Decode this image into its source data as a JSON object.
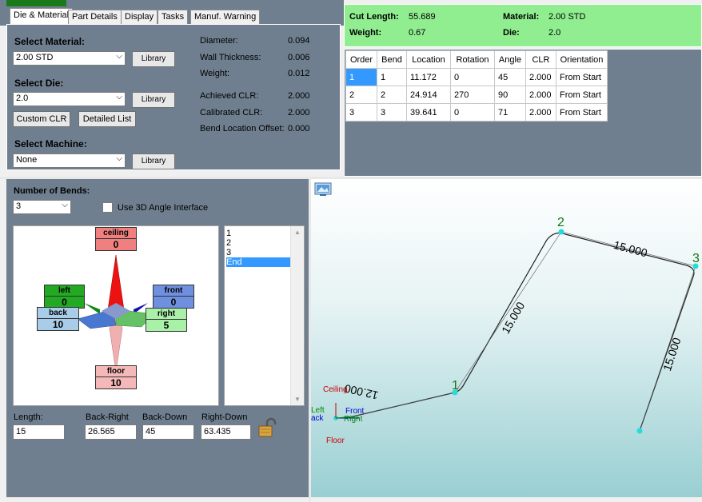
{
  "tabs": [
    "Die & Material",
    "Part Details",
    "Display",
    "Tasks",
    "Manuf. Warning"
  ],
  "die_material": {
    "select_material_label": "Select Material:",
    "material_value": "2.00 STD",
    "library_label": "Library",
    "select_die_label": "Select Die:",
    "die_value": "2.0",
    "custom_clr_label": "Custom CLR",
    "detailed_list_label": "Detailed List",
    "select_machine_label": "Select Machine:",
    "machine_value": "None",
    "props": [
      {
        "label": "Diameter:",
        "value": "0.094"
      },
      {
        "label": "Wall Thickness:",
        "value": "0.006"
      },
      {
        "label": "Weight:",
        "value": "0.012"
      },
      {
        "label": "Achieved CLR:",
        "value": "2.000"
      },
      {
        "label": "Calibrated CLR:",
        "value": "2.000"
      },
      {
        "label": "Bend Location Offset:",
        "value": "0.000"
      }
    ]
  },
  "summary": {
    "cut_length_label": "Cut Length:",
    "cut_length": "55.689",
    "weight_label": "Weight:",
    "weight": "0.67",
    "material_label": "Material:",
    "material": "2.00 STD",
    "die_label": "Die:",
    "die": "2.0"
  },
  "bend_table": {
    "headers": [
      "Order",
      "Bend",
      "Location",
      "Rotation",
      "Angle",
      "CLR",
      "Orientation"
    ],
    "rows": [
      [
        "1",
        "1",
        "11.172",
        "0",
        "45",
        "2.000",
        "From Start"
      ],
      [
        "2",
        "2",
        "24.914",
        "270",
        "90",
        "2.000",
        "From Start"
      ],
      [
        "3",
        "3",
        "39.641",
        "0",
        "71",
        "2.000",
        "From Start"
      ]
    ]
  },
  "bends": {
    "number_label": "Number of Bends:",
    "number_value": "3",
    "use_3d_label": "Use 3D Angle Interface",
    "list_items": [
      "1",
      "2",
      "3",
      "End"
    ],
    "compass": {
      "ceiling": {
        "label": "ceiling",
        "value": "0",
        "color": "#f08080"
      },
      "left": {
        "label": "left",
        "value": "0",
        "color": "#22aa22"
      },
      "front": {
        "label": "front",
        "value": "0",
        "color": "#6f8fe0"
      },
      "back": {
        "label": "back",
        "value": "10",
        "color": "#a9cde8"
      },
      "right": {
        "label": "right",
        "value": "5",
        "color": "#a9f0a9"
      },
      "floor": {
        "label": "floor",
        "value": "10",
        "color": "#f4b8b8"
      }
    },
    "fields": [
      {
        "label": "Length:",
        "value": "15"
      },
      {
        "label": "Back-Right",
        "value": "26.565"
      },
      {
        "label": "Back-Down",
        "value": "45"
      },
      {
        "label": "Right-Down",
        "value": "63.435"
      }
    ]
  },
  "viewer": {
    "segment_labels": [
      "12.000",
      "15.000",
      "15.000",
      "15.000"
    ],
    "bend_numbers": [
      "1",
      "2",
      "3"
    ],
    "axes": {
      "ceiling": "Ceiling",
      "floor": "Floor",
      "left": "Left",
      "back": "ack",
      "front": "Front",
      "right": "Right"
    }
  }
}
